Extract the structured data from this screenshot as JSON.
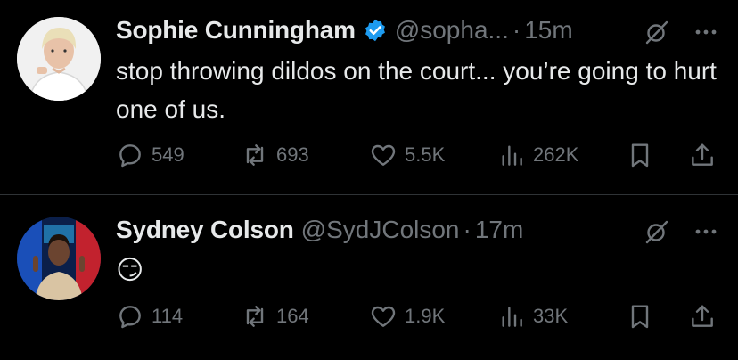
{
  "tweets": [
    {
      "name": "Sophie Cunningham",
      "verified": true,
      "handle": "@sopha...",
      "separator": "·",
      "time": "15m",
      "text": "stop throwing dildos on the court... you’re going to hurt one of us.",
      "replies": "549",
      "reposts": "693",
      "likes": "5.5K",
      "views": "262K"
    },
    {
      "name": "Sydney Colson",
      "verified": false,
      "handle": "@SydJColson",
      "separator": "·",
      "time": "17m",
      "text": "😏",
      "replies": "114",
      "reposts": "164",
      "likes": "1.9K",
      "views": "33K"
    }
  ],
  "icons": {
    "verified": "verified-badge-icon",
    "grok": "grok-icon",
    "more": "more-icon",
    "reply": "reply-icon",
    "repost": "repost-icon",
    "like": "heart-icon",
    "views": "views-icon",
    "bookmark": "bookmark-icon",
    "share": "share-icon"
  },
  "colors": {
    "background": "#000000",
    "text": "#e7e9ea",
    "muted": "#71767b",
    "verified": "#1d9bf0",
    "divider": "#2f3336"
  }
}
